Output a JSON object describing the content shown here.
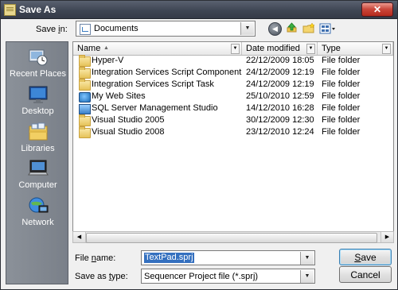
{
  "window": {
    "title": "Save As",
    "close_glyph": "✕"
  },
  "location": {
    "label_prefix": "Save ",
    "label_mnemonic": "i",
    "label_suffix": "n:",
    "current": "Documents"
  },
  "toolbar": {
    "back_icon": "back-arrow-icon",
    "up_icon": "up-one-level-icon",
    "new_folder_icon": "new-folder-icon",
    "views_icon": "views-menu-icon"
  },
  "places": [
    {
      "label": "Recent Places",
      "icon": "recent-places-icon"
    },
    {
      "label": "Desktop",
      "icon": "desktop-icon"
    },
    {
      "label": "Libraries",
      "icon": "libraries-icon"
    },
    {
      "label": "Computer",
      "icon": "computer-icon"
    },
    {
      "label": "Network",
      "icon": "network-icon"
    }
  ],
  "columns": {
    "name": "Name",
    "date": "Date modified",
    "type": "Type"
  },
  "files": [
    {
      "name": "Hyper-V",
      "date": "22/12/2009 18:05",
      "type": "File folder",
      "icon": "folder-icon"
    },
    {
      "name": "Integration Services Script Component",
      "date": "24/12/2009 12:19",
      "type": "File folder",
      "icon": "folder-icon"
    },
    {
      "name": "Integration Services Script Task",
      "date": "24/12/2009 12:19",
      "type": "File folder",
      "icon": "folder-icon"
    },
    {
      "name": "My Web Sites",
      "date": "25/10/2010 12:59",
      "type": "File folder",
      "icon": "web-sites-icon"
    },
    {
      "name": "SQL Server Management Studio",
      "date": "14/12/2010 16:28",
      "type": "File folder",
      "icon": "ssms-folder-icon"
    },
    {
      "name": "Visual Studio 2005",
      "date": "30/12/2009 12:30",
      "type": "File folder",
      "icon": "folder-icon"
    },
    {
      "name": "Visual Studio 2008",
      "date": "23/12/2010 12:24",
      "type": "File folder",
      "icon": "folder-icon"
    }
  ],
  "form": {
    "file_name_label_prefix": "File ",
    "file_name_label_mnemonic": "n",
    "file_name_label_suffix": "ame:",
    "file_name_value": "TextPad.sprj",
    "save_type_label_prefix": "Save as ",
    "save_type_label_mnemonic": "t",
    "save_type_label_suffix": "ype:",
    "save_type_value": "Sequencer Project file (*.sprj)"
  },
  "buttons": {
    "save_mnemonic": "S",
    "save_rest": "ave",
    "cancel": "Cancel"
  },
  "colors": {
    "title_bar": "#3f4654",
    "places_bar": "#7a8089",
    "selection": "#3470bf",
    "close_button": "#c9463a"
  }
}
